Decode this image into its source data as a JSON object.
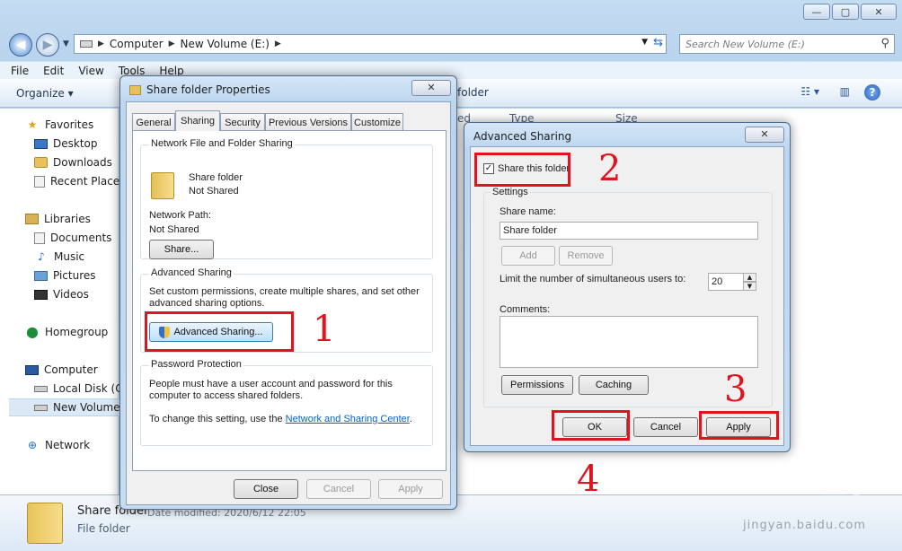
{
  "explorer": {
    "window_buttons": {
      "minimize": "—",
      "maximize": "▢",
      "close": "✕"
    },
    "address": {
      "crumbs": [
        "Computer",
        "New Volume (E:)"
      ]
    },
    "search_placeholder": "Search New Volume (E:)",
    "menu": [
      "File",
      "Edit",
      "View",
      "Tools",
      "Help"
    ],
    "command_bar": {
      "organize": "Organize",
      "path_tail": "folder"
    },
    "columns": [
      "ed",
      "Type",
      "Size"
    ],
    "sidebar": {
      "favorites": "Favorites",
      "desktop": "Desktop",
      "downloads": "Downloads",
      "recent": "Recent Places",
      "libraries": "Libraries",
      "documents": "Documents",
      "music": "Music",
      "pictures": "Pictures",
      "videos": "Videos",
      "homegroup": "Homegroup",
      "computer": "Computer",
      "local_disk": "Local Disk (C:",
      "new_volume": "New Volume",
      "network": "Network"
    },
    "details": {
      "name": "Share folder",
      "meta": "Date modified: 2020/6/12 22:05",
      "type": "File folder"
    }
  },
  "properties": {
    "title": "Share folder Properties",
    "close": "✕",
    "tabs": [
      "General",
      "Sharing",
      "Security",
      "Previous Versions",
      "Customize"
    ],
    "network_group": "Network File and Folder Sharing",
    "folder_name": "Share folder",
    "folder_status": "Not Shared",
    "network_path_label": "Network Path:",
    "network_path_value": "Not Shared",
    "share_button": "Share...",
    "advanced_group": "Advanced Sharing",
    "advanced_desc_1": "Set custom permissions, create multiple shares, and set other",
    "advanced_desc_2": "advanced sharing options.",
    "advanced_button": "Advanced Sharing...",
    "password_group": "Password Protection",
    "password_desc_1": "People must have a user account and password for this",
    "password_desc_2": "computer to access shared folders.",
    "password_change_prefix": "To change this setting, use the ",
    "password_link": "Network and Sharing Center",
    "password_change_suffix": ".",
    "close_button": "Close",
    "cancel_button": "Cancel",
    "apply_button": "Apply"
  },
  "advanced": {
    "title": "Advanced Sharing",
    "close": "✕",
    "share_checkbox_label": "Share this folder",
    "share_checked": true,
    "settings_group": "Settings",
    "share_name_label": "Share name:",
    "share_name_value": "Share folder",
    "add_button": "Add",
    "remove_button": "Remove",
    "limit_label": "Limit the number of simultaneous users to:",
    "limit_value": "20",
    "comments_label": "Comments:",
    "permissions_button": "Permissions",
    "caching_button": "Caching",
    "ok_button": "OK",
    "cancel_button": "Cancel",
    "apply_button": "Apply"
  },
  "annotations": [
    "1",
    "2",
    "3",
    "4"
  ],
  "watermark": {
    "main": "Bai du 经验",
    "sub": "jingyan.baidu.com"
  },
  "colors": {
    "annotation_red": "#e0141e",
    "link_blue": "#0b5fc2"
  }
}
